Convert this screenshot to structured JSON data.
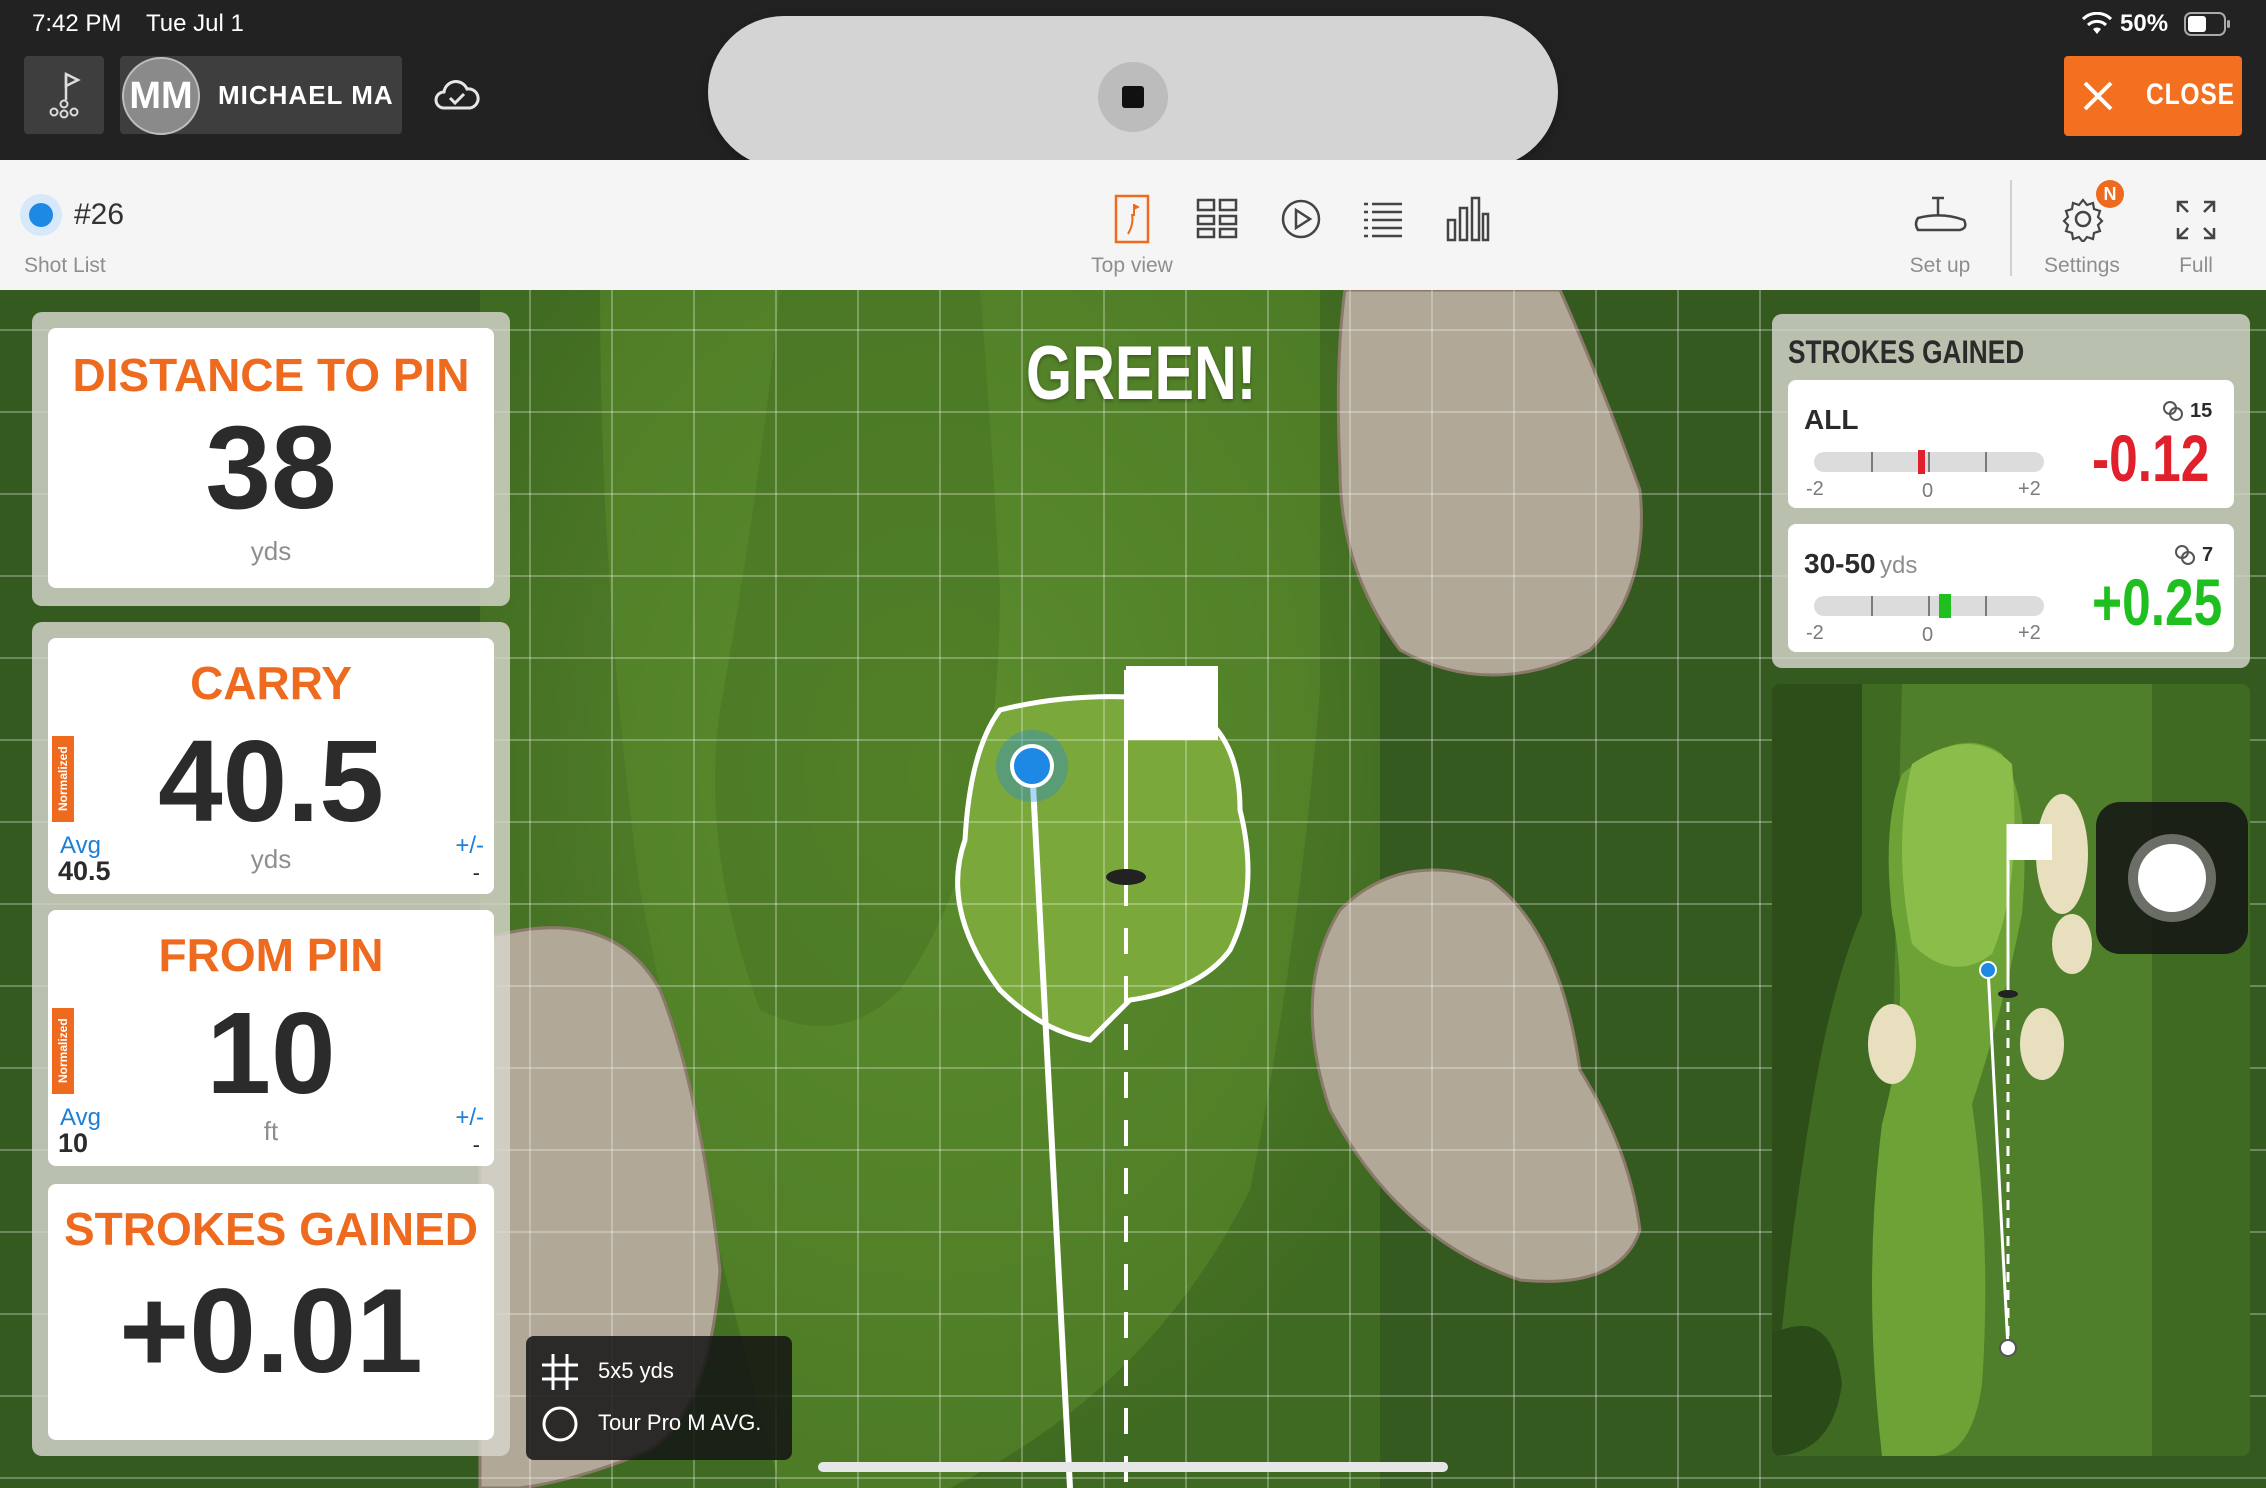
{
  "status_bar": {
    "time": "7:42 PM",
    "date": "Tue Jul 1",
    "battery": "50%"
  },
  "header": {
    "user_initials": "MM",
    "user_name": "MICHAEL MA",
    "close_label": "CLOSE"
  },
  "toolbar": {
    "shot_number": "#26",
    "shot_list_label": "Shot List",
    "top_view_label": "Top view",
    "setup_label": "Set up",
    "settings_label": "Settings",
    "settings_badge": "N",
    "full_label": "Full"
  },
  "view": {
    "result_text": "GREEN!"
  },
  "stats": {
    "distance_to_pin": {
      "title": "DISTANCE TO PIN",
      "value": "38",
      "unit": "yds"
    },
    "carry": {
      "title": "CARRY",
      "value": "40.5",
      "unit": "yds",
      "tag": "Normalized",
      "avg_label": "Avg",
      "avg_value": "40.5",
      "pm_label": "+/-",
      "pm_value": "-"
    },
    "from_pin": {
      "title": "FROM PIN",
      "value": "10",
      "unit": "ft",
      "tag": "Normalized",
      "avg_label": "Avg",
      "avg_value": "10",
      "pm_label": "+/-",
      "pm_value": "-"
    },
    "strokes_gained": {
      "title": "STROKES GAINED",
      "value": "+0.01"
    }
  },
  "strokes_gained_panel": {
    "title": "STROKES GAINED",
    "rows": [
      {
        "label": "ALL",
        "sub": "",
        "count": "15",
        "value": "-0.12",
        "level": -0.12,
        "color": "#e0202b",
        "scale_min": "-2",
        "scale_mid": "0",
        "scale_max": "+2"
      },
      {
        "label": "30-50",
        "sub": "yds",
        "count": "7",
        "value": "+0.25",
        "level": 0.25,
        "color": "#1fbf1f",
        "scale_min": "-2",
        "scale_mid": "0",
        "scale_max": "+2"
      }
    ]
  },
  "legend": {
    "grid_label": "5x5 yds",
    "ring_label": "Tour Pro M AVG."
  },
  "colors": {
    "accent": "#ee6a1f",
    "close_bg": "#f37021",
    "ball": "#1e88e5",
    "positive": "#1fbf1f",
    "negative": "#e0202b"
  },
  "icons": [
    "course-flag-icon",
    "cloud-check-icon",
    "close-x-icon",
    "top-view-icon",
    "grid-view-icon",
    "play-icon",
    "list-icon",
    "bar-chart-icon",
    "setup-tee-icon",
    "gear-icon",
    "fullscreen-icon",
    "wifi-icon",
    "battery-icon",
    "grid-hash-icon",
    "ring-icon",
    "shot-count-icon"
  ]
}
